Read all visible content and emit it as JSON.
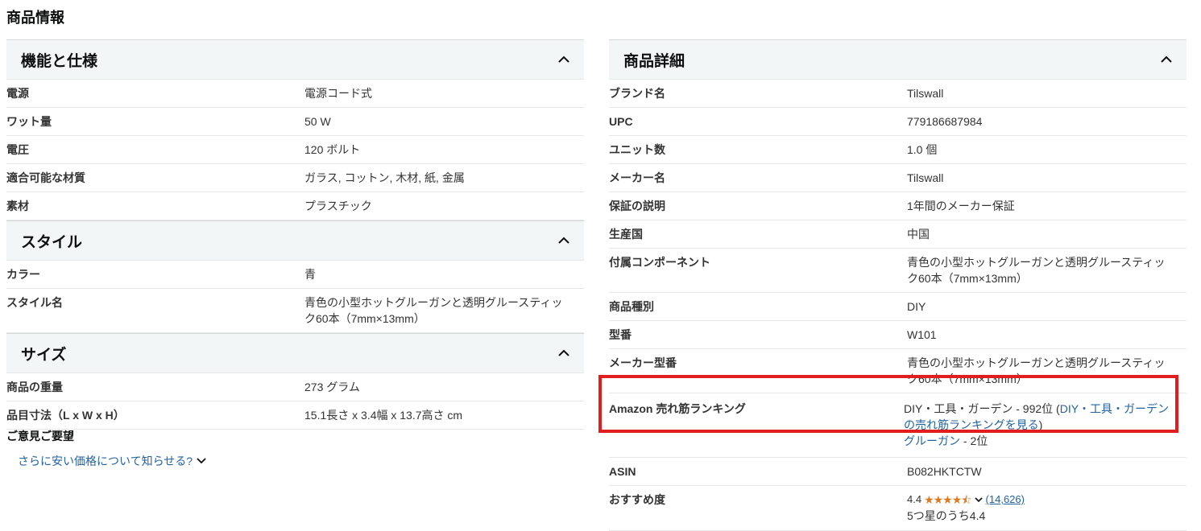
{
  "page_title": "商品情報",
  "left": {
    "features": {
      "title": "機能と仕様",
      "rows": [
        {
          "k": "電源",
          "v": "電源コード式"
        },
        {
          "k": "ワット量",
          "v": "50 W"
        },
        {
          "k": "電圧",
          "v": "120 ボルト"
        },
        {
          "k": "適合可能な材質",
          "v": "ガラス, コットン, 木材, 紙, 金属"
        },
        {
          "k": "素材",
          "v": "プラスチック"
        }
      ]
    },
    "style": {
      "title": "スタイル",
      "rows": [
        {
          "k": "カラー",
          "v": "青"
        },
        {
          "k": "スタイル名",
          "v": "青色の小型ホットグルーガンと透明グルースティック60本（7mm×13mm）"
        }
      ]
    },
    "size": {
      "title": "サイズ",
      "rows": [
        {
          "k": "商品の重量",
          "v": "273 グラム"
        },
        {
          "k": "品目寸法（L x W x H）",
          "v": "15.1長さ x 3.4幅 x 13.7高さ cm"
        }
      ]
    },
    "feedback_title": "ご意見ご要望",
    "price_link": "さらに安い価格について知らせる?"
  },
  "right": {
    "details": {
      "title": "商品詳細",
      "rows": [
        {
          "k": "ブランド名",
          "v": "Tilswall"
        },
        {
          "k": "UPC",
          "v": "779186687984"
        },
        {
          "k": "ユニット数",
          "v": "1.0 個"
        },
        {
          "k": "メーカー名",
          "v": "Tilswall"
        },
        {
          "k": "保証の説明",
          "v": "1年間のメーカー保証"
        },
        {
          "k": "生産国",
          "v": "中国"
        },
        {
          "k": "付属コンポーネント",
          "v": "青色の小型ホットグルーガンと透明グルースティック60本（7mm×13mm）"
        },
        {
          "k": "商品種別",
          "v": "DIY"
        },
        {
          "k": "型番",
          "v": "W101"
        },
        {
          "k": "メーカー型番",
          "v": "青色の小型ホットグルーガンと透明グルースティック60本（7mm×13mm）"
        }
      ]
    },
    "ranking": {
      "k": "Amazon 売れ筋ランキング",
      "category_prefix": "DIY・工具・ガーデン - 992位 (",
      "category_link": "DIY・工具・ガーデンの売れ筋ランキングを見る",
      "category_suffix": ")",
      "sub_link": "グルーガン",
      "sub_rank": " - 2位"
    },
    "asin": {
      "k": "ASIN",
      "v": "B082HKTCTW"
    },
    "rating": {
      "k": "おすすめ度",
      "score": "4.4",
      "stars": "★★★★⯪",
      "count": "(14,626)",
      "text": "5つ星のうち4.4"
    }
  },
  "colors": {
    "accent_link": "#2162a1",
    "highlight": "#e11d1d",
    "star": "#de7921",
    "header_bg": "#f3f6f7"
  },
  "icons": {
    "collapse": "chevron-up-icon",
    "expand_more": "chevron-down-icon"
  }
}
